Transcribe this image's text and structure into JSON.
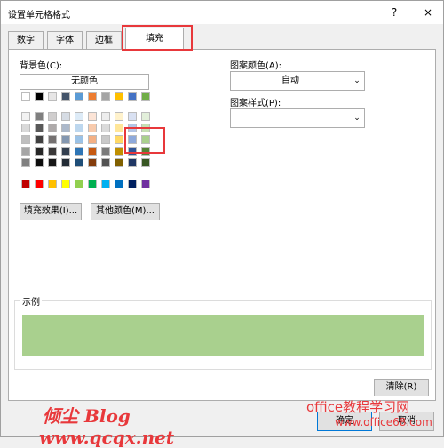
{
  "window": {
    "title": "设置单元格格式",
    "help": "?",
    "close": "×"
  },
  "tabs": [
    "数字",
    "字体",
    "边框",
    "填充"
  ],
  "background": {
    "label": "背景色(C):",
    "no_color": "无颜色"
  },
  "palette": {
    "theme_top": [
      "#ffffff",
      "#000000",
      "#e7e6e6",
      "#44546a",
      "#5b9bd5",
      "#ed7d31",
      "#a5a5a5",
      "#ffc000",
      "#4472c4",
      "#70ad47"
    ],
    "theme_shades": [
      [
        "#f2f2f2",
        "#7f7f7f",
        "#d0cece",
        "#d6dce4",
        "#ddebf7",
        "#fce4d6",
        "#ededed",
        "#fff2cc",
        "#d9e1f2",
        "#e2efda"
      ],
      [
        "#d9d9d9",
        "#595959",
        "#aeaaaa",
        "#adb9ca",
        "#bdd7ee",
        "#f8cbad",
        "#dbdbdb",
        "#ffe699",
        "#b4c6e7",
        "#c6e0b4"
      ],
      [
        "#bfbfbf",
        "#404040",
        "#757171",
        "#8497b0",
        "#9bc2e6",
        "#f4b084",
        "#c9c9c9",
        "#ffd966",
        "#8ea9db",
        "#a9d08e"
      ],
      [
        "#a6a6a6",
        "#262626",
        "#3a3838",
        "#333f4f",
        "#2f75b5",
        "#c65911",
        "#7b7b7b",
        "#bf8f00",
        "#305496",
        "#548235"
      ],
      [
        "#808080",
        "#0d0d0d",
        "#161616",
        "#222b35",
        "#1f4e78",
        "#833c0c",
        "#525252",
        "#806000",
        "#203764",
        "#375623"
      ]
    ],
    "standard": [
      "#c00000",
      "#ff0000",
      "#ffc000",
      "#ffff00",
      "#92d050",
      "#00b050",
      "#00b0f0",
      "#0070c0",
      "#002060",
      "#7030a0"
    ]
  },
  "buttons": {
    "fill_effects": "填充效果(I)...",
    "more_colors": "其他颜色(M)...",
    "clear": "清除(R)",
    "ok": "确定",
    "cancel": "取消"
  },
  "pattern": {
    "color_label": "图案颜色(A):",
    "color_value": "自动",
    "style_label": "图案样式(P):",
    "style_value": ""
  },
  "sample": {
    "label": "示例",
    "color": "#a9d08e"
  },
  "watermarks": {
    "blog": "倾尘 Blog",
    "url": "www.qcqx.net",
    "site": "office教程学习网",
    "site_url": "www.office68.com"
  }
}
